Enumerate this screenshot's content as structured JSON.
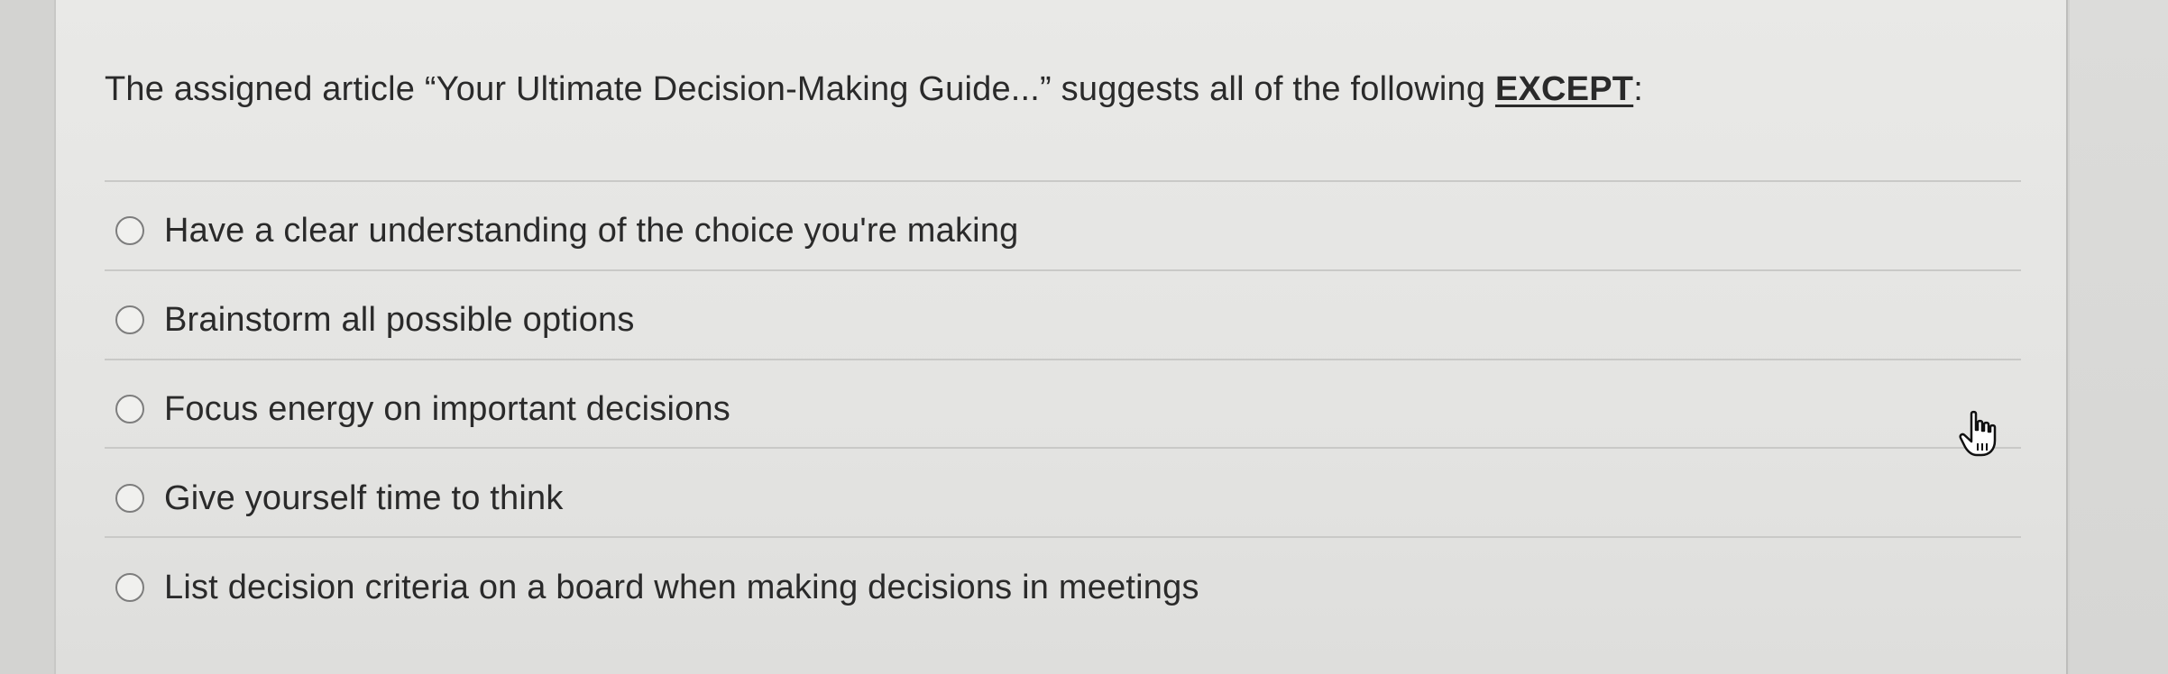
{
  "question": {
    "text_before": "The assigned article “Your Ultimate Decision-Making Guide...” suggests all of the following ",
    "emphasis": "EXCEPT",
    "text_after": ":"
  },
  "options": [
    {
      "label": "Have a clear understanding of the choice you're making",
      "selected": false
    },
    {
      "label": "Brainstorm all possible options",
      "selected": false
    },
    {
      "label": "Focus energy on important decisions",
      "selected": false
    },
    {
      "label": "Give yourself time to think",
      "selected": false
    },
    {
      "label": "List decision criteria on a board when making decisions in meetings",
      "selected": false
    }
  ],
  "cursor": {
    "icon": "hand-pointer-icon"
  }
}
